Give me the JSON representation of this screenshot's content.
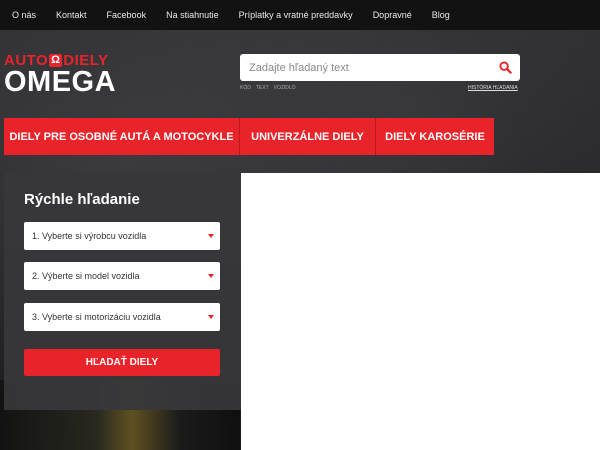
{
  "topnav": [
    "O nás",
    "Kontakt",
    "Facebook",
    "Na stiahnutie",
    "Príplatky a vratné preddavky",
    "Dopravné",
    "Blog"
  ],
  "logo": {
    "top_left": "AUTO",
    "symbol": "Ω",
    "top_right": "DIELY",
    "bottom": "OMEGA"
  },
  "search": {
    "placeholder": "Zadajte hľadaný text",
    "options": [
      "KÓD",
      "TEXT",
      "VOZIDLO"
    ],
    "history_link": "HISTÓRIA HĽADANIA"
  },
  "categories": [
    "DIELY PRE OSOBNÉ AUTÁ A MOTOCYKLE",
    "UNIVERZÁLNE DIELY",
    "DIELY KAROSÉRIE"
  ],
  "quick_search": {
    "title": "Rýchle hľadanie",
    "selects": [
      "1. Vyberte si výrobcu vozidla",
      "2. Výberte si model vozidla",
      "3. Vyberte si motorizáciu vozidla"
    ],
    "button": "HĽADAŤ DIELY"
  },
  "colors": {
    "accent": "#e8232a",
    "topbar": "#121212",
    "panel": "#37373a"
  }
}
